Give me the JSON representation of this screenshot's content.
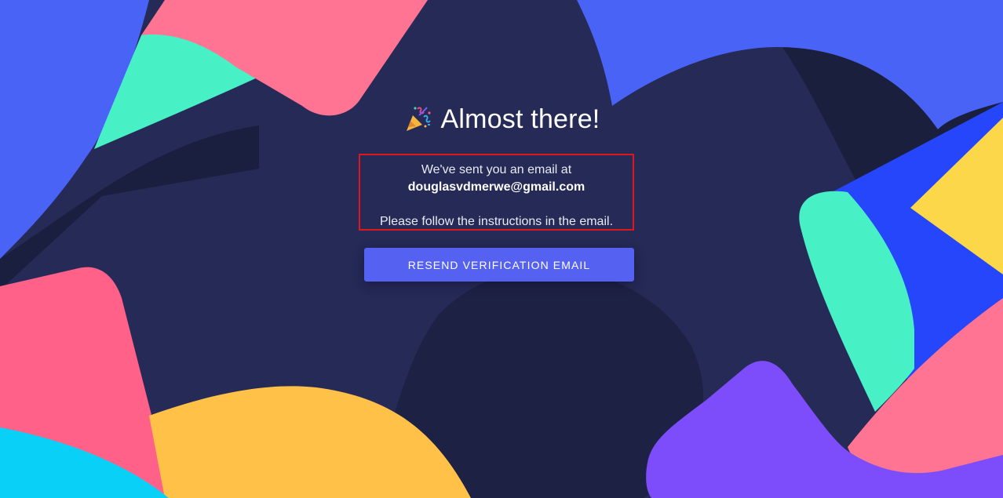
{
  "page": {
    "title": "Almost there!",
    "title_icon": "party-popper-icon"
  },
  "message": {
    "line1": "We've sent you an email at",
    "email": "douglasvdmerwe@gmail.com",
    "line2": "Please follow the instructions in the email."
  },
  "actions": {
    "resend_label": "RESEND VERIFICATION EMAIL"
  },
  "colors": {
    "background": "#252a56",
    "button": "#5562f1",
    "highlight_border": "#e0161e",
    "shape_blue": "#4a63f7",
    "shape_pink": "#fe7492",
    "shape_mint": "#48f0c6",
    "shape_yellow": "#ffc148",
    "shape_purple": "#7d4dfb",
    "shape_cyan": "#08d0f7"
  }
}
